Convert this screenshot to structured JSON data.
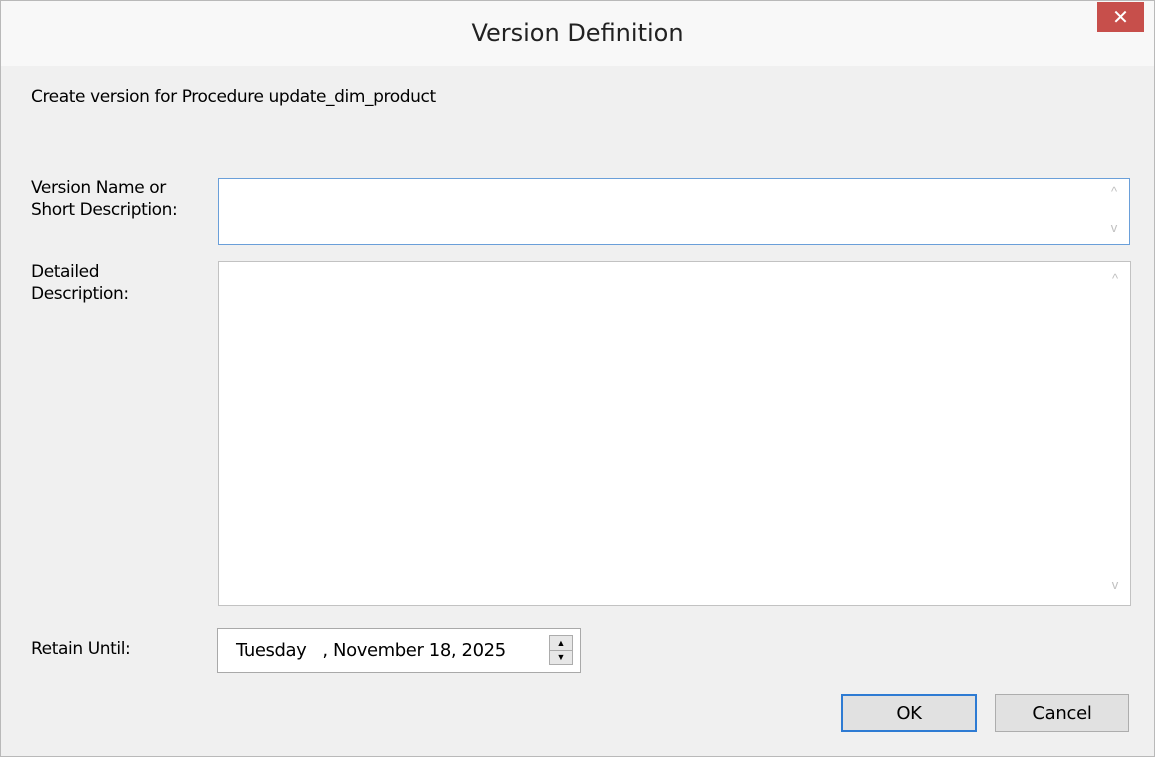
{
  "window": {
    "title": "Version Definition",
    "close_glyph": "✕"
  },
  "header_text": "Create version for Procedure update_dim_product",
  "fields": {
    "version_name_label": "Version Name or\nShort Description:",
    "version_name_value": "",
    "detailed_description_label": "Detailed\nDescription:",
    "detailed_description_value": "",
    "retain_until_label": "Retain Until:",
    "retain_until_value": "Tuesday   , November 18, 2025"
  },
  "buttons": {
    "ok_label": "OK",
    "cancel_label": "Cancel"
  },
  "icons": {
    "scroll_up": "^",
    "scroll_down": "v",
    "spin_up": "▲",
    "spin_down": "▼"
  },
  "colors": {
    "close_button": "#c74f4b",
    "focus_border": "#6a9fd9",
    "default_button_border": "#2e7bd3"
  }
}
